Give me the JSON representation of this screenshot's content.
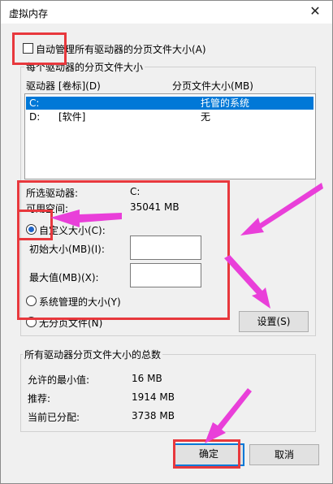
{
  "dialog": {
    "title": "虚拟内存",
    "close_glyph": "✕"
  },
  "auto_manage": {
    "label": "自动管理所有驱动器的分页文件大小(A)",
    "checked": false
  },
  "per_drive": {
    "legend": "每个驱动器的分页文件大小",
    "columns": [
      "驱动器 [卷标](D)",
      "分页文件大小(MB)"
    ],
    "drives": [
      {
        "drive": "C:",
        "label": "",
        "size": "托管的系统",
        "selected": true
      },
      {
        "drive": "D:",
        "label": "[软件]",
        "size": "无",
        "selected": false
      }
    ],
    "selected_label": "所选驱动器:",
    "selected_value": "C:",
    "free_label": "可用空间:",
    "free_value": "35041 MB",
    "custom_label": "自定义大小(C):",
    "initial_label": "初始大小(MB)(I):",
    "initial_value": "",
    "max_label": "最大值(MB)(X):",
    "max_value": "",
    "system_label": "系统管理的大小(Y)",
    "none_label": "无分页文件(N)",
    "set_button": "设置(S)"
  },
  "totals": {
    "legend": "所有驱动器分页文件大小的总数",
    "min_label": "允许的最小值:",
    "min_value": "16 MB",
    "rec_label": "推荐:",
    "rec_value": "1914 MB",
    "cur_label": "当前已分配:",
    "cur_value": "3738 MB"
  },
  "buttons": {
    "ok": "确定",
    "cancel": "取消"
  },
  "colors": {
    "highlight_box": "#e8383d",
    "arrow": "#e93fd9",
    "selection": "#0078d7"
  }
}
